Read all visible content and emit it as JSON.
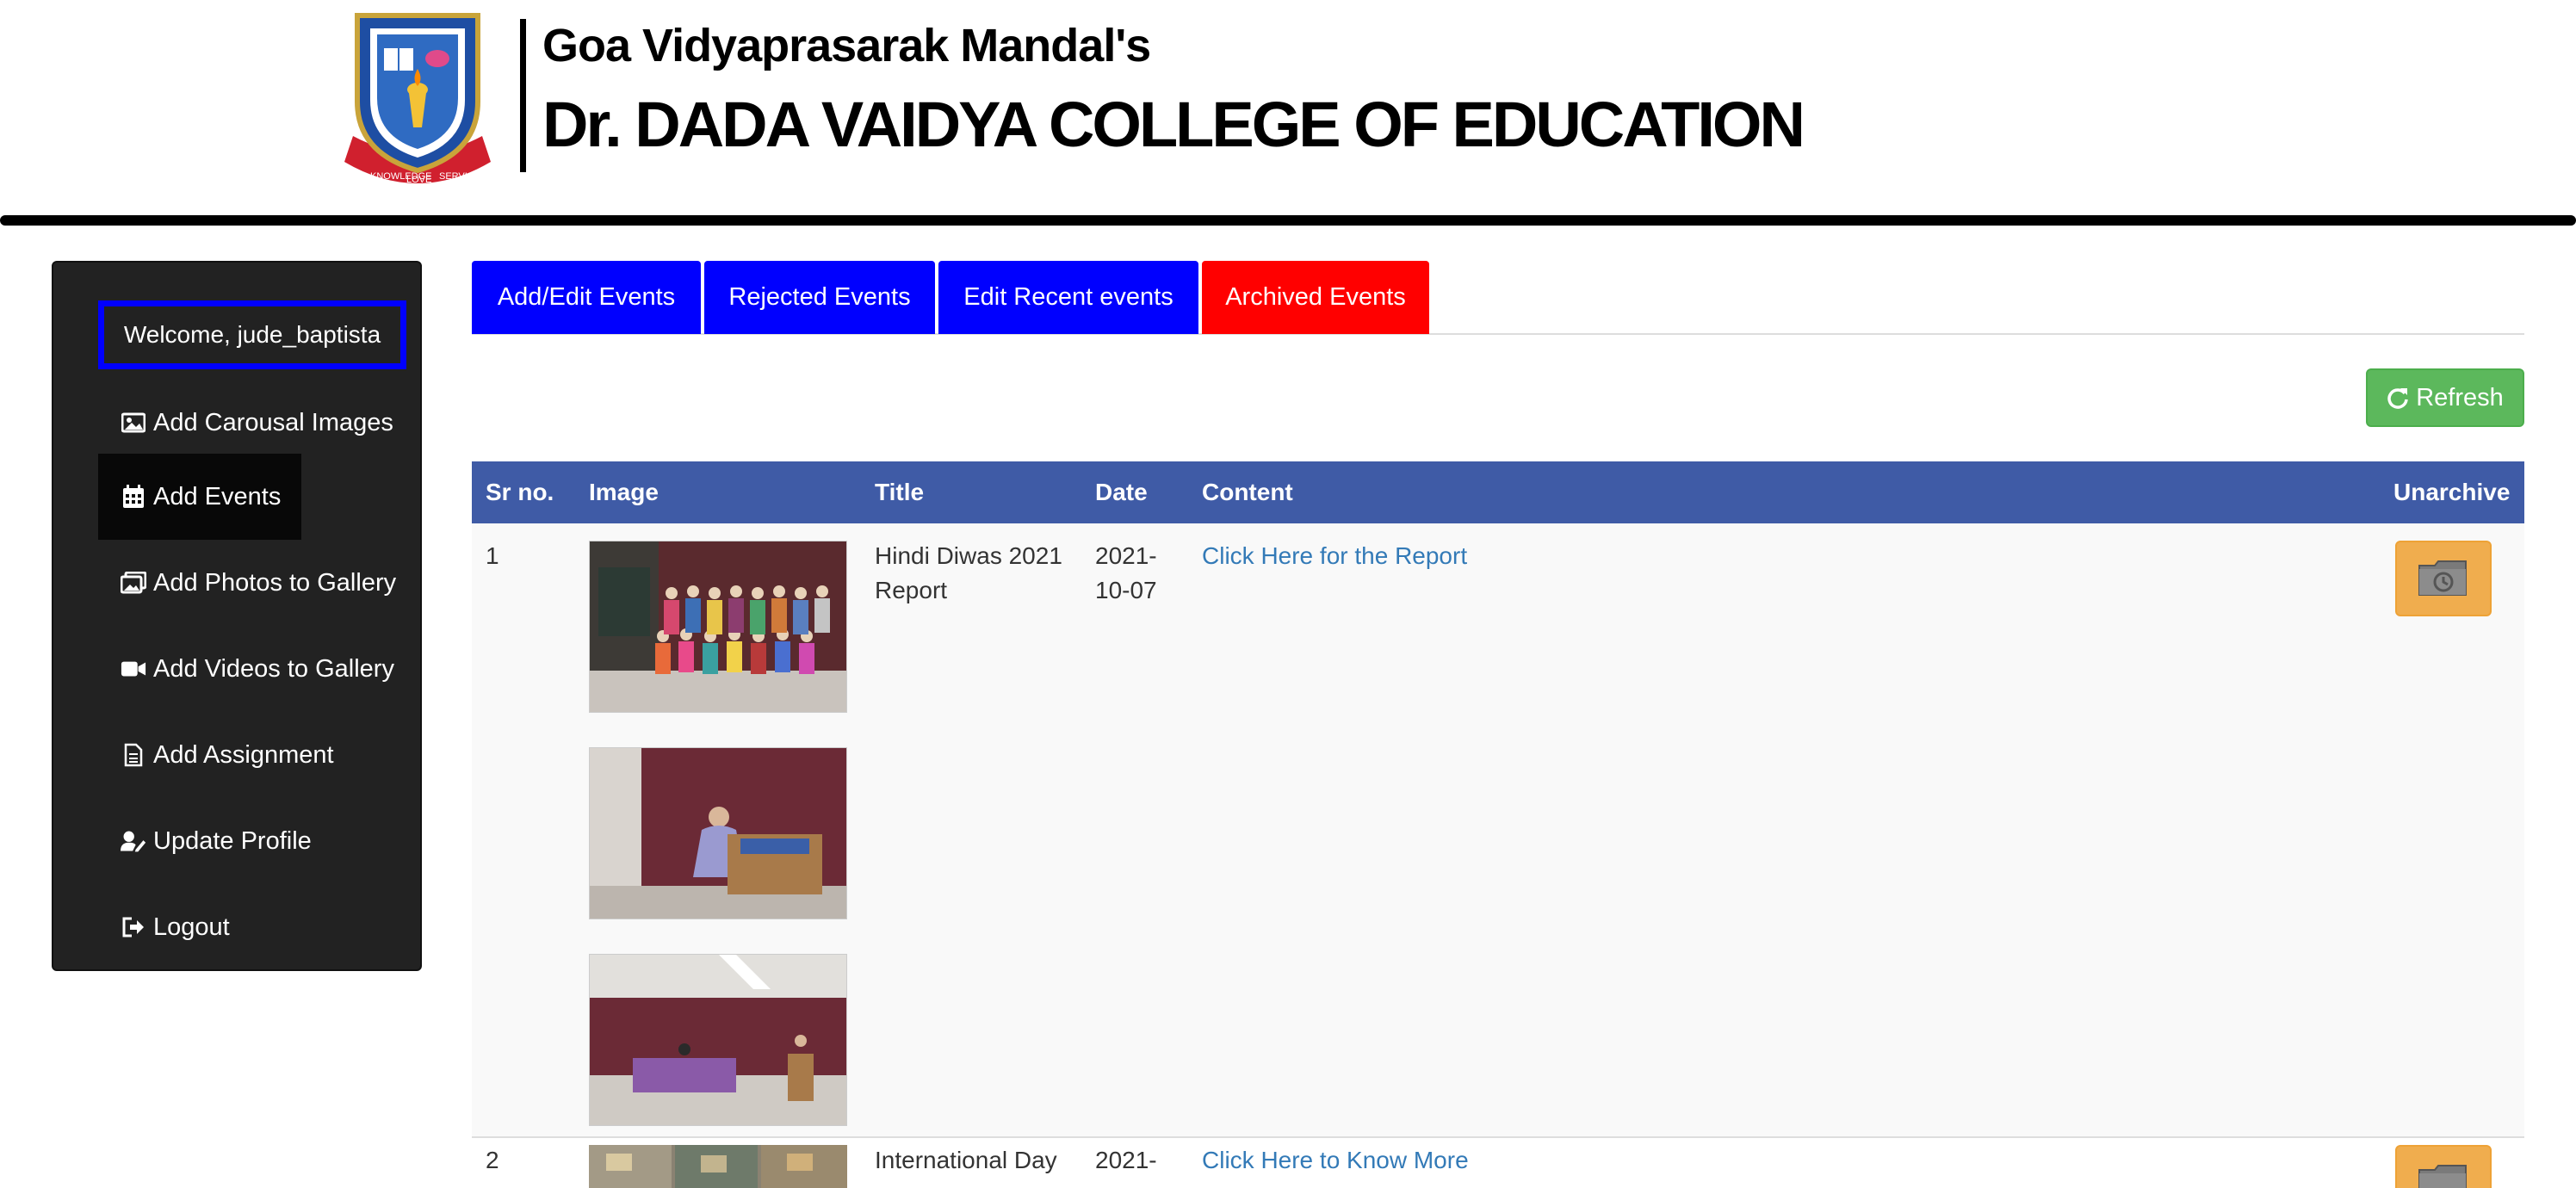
{
  "header": {
    "subtitle": "Goa Vidyaprasarak Mandal's",
    "title": "Dr. DADA VAIDYA COLLEGE OF EDUCATION",
    "logo_text": [
      "KNOWLEDGE",
      "LOVE",
      "SERVICE"
    ]
  },
  "sidebar": {
    "welcome": "Welcome, jude_baptista",
    "items": [
      {
        "label": "Add Carousal Images",
        "icon": "image-icon"
      },
      {
        "label": "Add Events",
        "icon": "calendar-icon"
      },
      {
        "label": "Add Photos to Gallery",
        "icon": "images-icon"
      },
      {
        "label": "Add Videos to Gallery",
        "icon": "video-icon"
      },
      {
        "label": "Add Assignment",
        "icon": "file-text-icon"
      },
      {
        "label": "Update Profile",
        "icon": "user-edit-icon"
      },
      {
        "label": "Logout",
        "icon": "sign-out-icon"
      }
    ],
    "active_item": "Add Events"
  },
  "tabs": [
    {
      "label": "Add/Edit Events",
      "color": "#0000ff"
    },
    {
      "label": "Rejected Events",
      "color": "#0000ff"
    },
    {
      "label": "Edit Recent events",
      "color": "#0000ff"
    },
    {
      "label": "Archived Events",
      "color": "#ff0000"
    }
  ],
  "refresh_label": "Refresh",
  "table": {
    "headers": [
      "Sr no.",
      "Image",
      "Title",
      "Date",
      "Content",
      "Unarchive"
    ],
    "rows": [
      {
        "sr": "1",
        "title": "Hindi Diwas 2021 Report",
        "date": "2021-10-07",
        "content": "Click Here for the Report",
        "images": [
          "group-photo",
          "speaker-at-podium",
          "hall-with-stage"
        ]
      },
      {
        "sr": "2",
        "title": "International Day",
        "date": "2021-",
        "content": "Click Here to Know More",
        "images": [
          "collage"
        ]
      }
    ]
  },
  "colors": {
    "header_row": "#3f5ba6",
    "tab_active": "#ff0000",
    "tab": "#0000ff",
    "refresh": "#5cb85c",
    "unarchive": "#f0ad4e",
    "sidebar_bg": "#222222",
    "link": "#337ab7"
  }
}
